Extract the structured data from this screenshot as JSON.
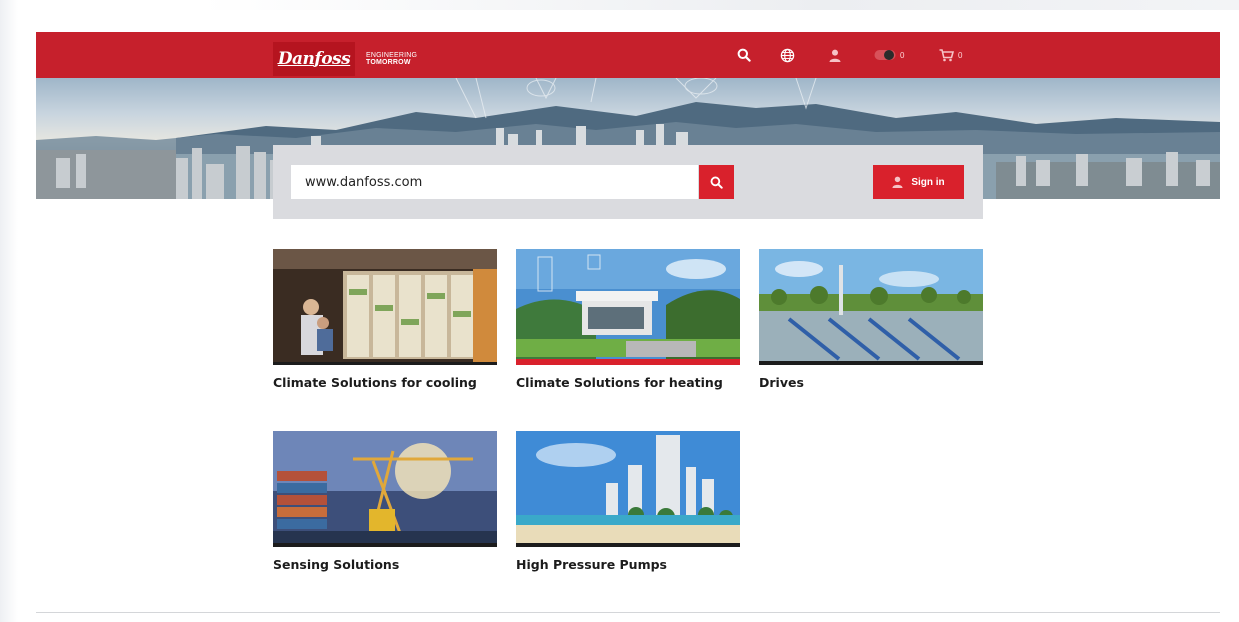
{
  "header": {
    "brand": "Danfoss",
    "tagline_top": "ENGINEERING",
    "tagline_bottom": "TOMORROW",
    "icons": [
      "search-icon",
      "globe-icon",
      "user-icon",
      "toggle-icon",
      "cart-icon"
    ],
    "toggle_count": "0",
    "cart_count": "0"
  },
  "search": {
    "value": "www.danfoss.com",
    "button_icon": "search-icon"
  },
  "signin": {
    "label": "Sign in",
    "icon": "user-icon"
  },
  "cards": [
    {
      "label": "Climate Solutions for cooling"
    },
    {
      "label": "Climate Solutions for heating"
    },
    {
      "label": "Drives"
    },
    {
      "label": "Sensing Solutions"
    },
    {
      "label": "High Pressure Pumps"
    }
  ],
  "colors": {
    "brand_red": "#c6202c",
    "button_red": "#d9212c",
    "panel_gray": "#dadbdf"
  }
}
